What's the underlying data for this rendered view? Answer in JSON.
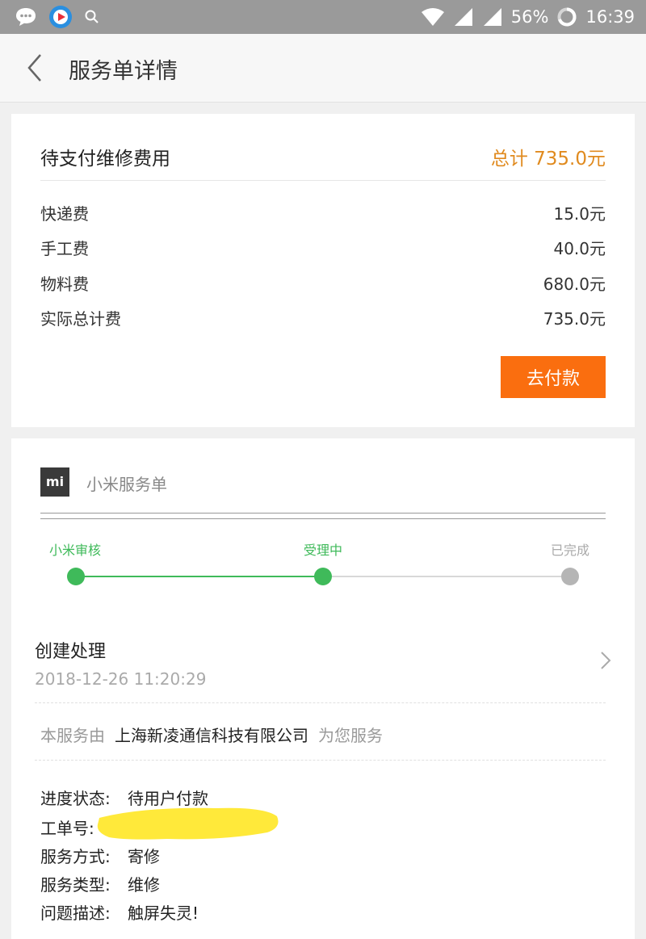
{
  "status_bar": {
    "battery": "56%",
    "time": "16:39",
    "icons": [
      "chat-bubble-icon",
      "video-app-icon",
      "search-icon",
      "wifi-icon",
      "signal-icon",
      "signal-icon",
      "battery-ring-icon"
    ]
  },
  "header": {
    "title": "服务单详情",
    "back_icon": "chevron-left-icon"
  },
  "fee_card": {
    "title": "待支付维修费用",
    "total": "总计 735.0元",
    "rows": [
      {
        "label": "快递费",
        "value": "15.0元"
      },
      {
        "label": "手工费",
        "value": "40.0元"
      },
      {
        "label": "物料费",
        "value": "680.0元"
      },
      {
        "label": "实际总计费",
        "value": "735.0元"
      }
    ],
    "pay_button": "去付款"
  },
  "order_card": {
    "logo_text": "mi",
    "title": "小米服务单",
    "steps": [
      {
        "label": "小米审核",
        "state": "done"
      },
      {
        "label": "受理中",
        "state": "done"
      },
      {
        "label": "已完成",
        "state": "pending"
      }
    ],
    "create": {
      "title": "创建处理",
      "time": "2018-12-26 11:20:29"
    },
    "provider": {
      "prefix": "本服务由",
      "company": "上海新凌通信科技有限公司",
      "suffix": "为您服务"
    },
    "details": [
      {
        "label": "进度状态:",
        "value": "待用户付款"
      },
      {
        "label": "工单号:",
        "value": ""
      },
      {
        "label": "服务方式:",
        "value": "寄修"
      },
      {
        "label": "服务类型:",
        "value": "维修"
      },
      {
        "label": "问题描述:",
        "value": "触屏失灵!"
      }
    ]
  },
  "colors": {
    "accent_orange": "#fa6e0f",
    "total_orange": "#e08a1e",
    "step_green": "#3fba5a",
    "step_gray": "#b5b5b5",
    "highlighter_yellow": "#ffe93a"
  }
}
